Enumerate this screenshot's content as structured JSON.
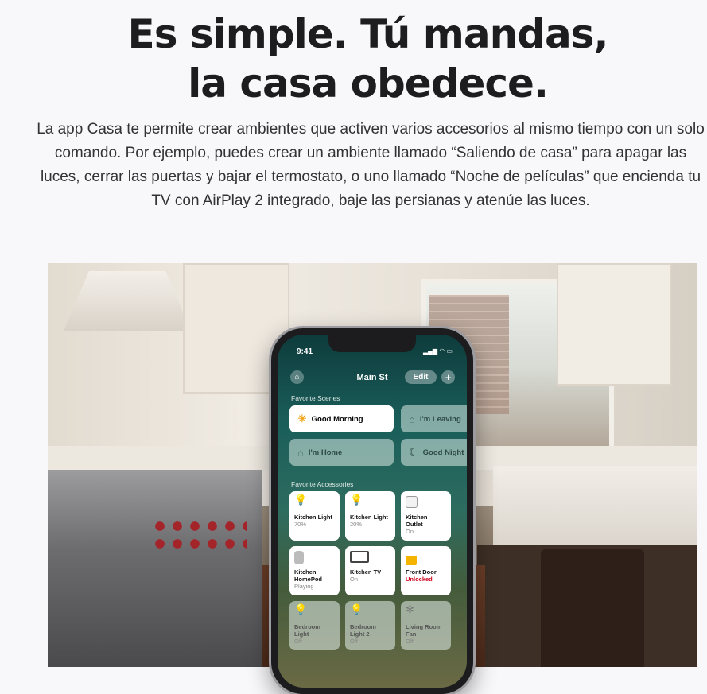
{
  "hero": {
    "headline_line1": "Es simple. Tú mandas,",
    "headline_line2": "la casa obedece.",
    "body": "La app Casa te permite crear ambientes que activen varios accesorios al mismo tiempo con un solo comando. Por ejemplo, puedes crear un ambiente llamado “Saliendo de casa” para apagar las luces, cerrar las puertas y bajar el termostato, o uno llamado “Noche de películas” que encienda tu TV con AirPlay 2 integrado, baje las persianas y atenúe las luces."
  },
  "phone": {
    "status_time": "9:41",
    "status_icons": "▂▄▆ ◠ ▭",
    "home_title": "Main St",
    "edit_label": "Edit",
    "add_label": "+",
    "favorite_scenes_label": "Favorite Scenes",
    "scenes": [
      {
        "name": "Good Morning",
        "icon": "sun-house-icon",
        "glyph": "☀",
        "active": true
      },
      {
        "name": "I'm Leaving",
        "icon": "leaving-house-icon",
        "glyph": "⌂",
        "active": false
      },
      {
        "name": "I'm Home",
        "icon": "arriving-house-icon",
        "glyph": "⌂",
        "active": false
      },
      {
        "name": "Good Night",
        "icon": "moon-house-icon",
        "glyph": "☾",
        "active": false
      }
    ],
    "favorite_accessories_label": "Favorite Accessories",
    "accessories": [
      {
        "name": "Kitchen Light",
        "status": "70%",
        "icon": "lightbulb-icon",
        "on": true
      },
      {
        "name": "Kitchen Light",
        "status": "20%",
        "icon": "lightbulb-icon",
        "on": true
      },
      {
        "name": "Kitchen Outlet",
        "status": "On",
        "icon": "outlet-icon",
        "on": true
      },
      {
        "name": "Kitchen HomePod",
        "status": "Playing",
        "icon": "homepod-icon",
        "on": true
      },
      {
        "name": "Kitchen TV",
        "status": "On",
        "icon": "tv-icon",
        "on": true
      },
      {
        "name": "Front Door",
        "status": "Unlocked",
        "icon": "lock-icon",
        "on": true
      },
      {
        "name": "Bedroom Light",
        "status": "Off",
        "icon": "lightbulb-icon",
        "on": false
      },
      {
        "name": "Bedroom Light 2",
        "status": "Off",
        "icon": "lightbulb-icon",
        "on": false
      },
      {
        "name": "Living Room Fan",
        "status": "Off",
        "icon": "fan-icon",
        "on": false
      }
    ]
  }
}
